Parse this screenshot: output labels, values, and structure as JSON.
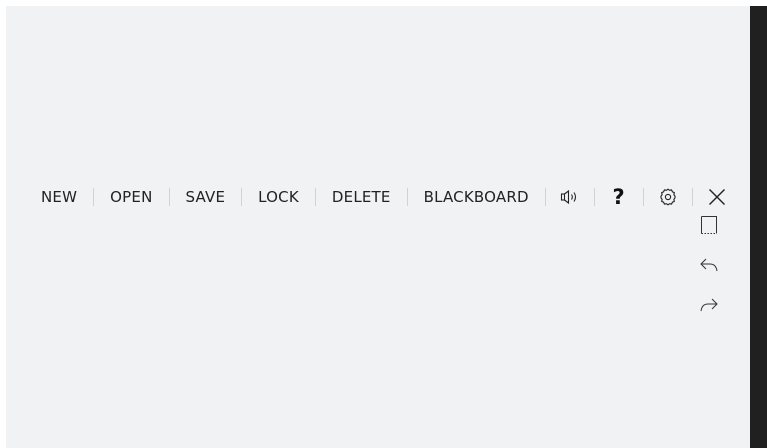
{
  "toolbar": {
    "new_label": "NEW",
    "open_label": "OPEN",
    "save_label": "SAVE",
    "lock_label": "LOCK",
    "delete_label": "DELETE",
    "blackboard_label": "BLACKBOARD",
    "help_label": "?",
    "icons": [
      "speaker-icon",
      "help-icon",
      "gear-icon",
      "close-icon"
    ]
  },
  "side_tools": {
    "icons": [
      "page-icon",
      "undo-icon",
      "redo-icon"
    ]
  },
  "colors": {
    "canvas_bg": "#f1f2f4",
    "text": "#222222",
    "separator": "#cfd2d6",
    "edge_strip": "#202020"
  }
}
